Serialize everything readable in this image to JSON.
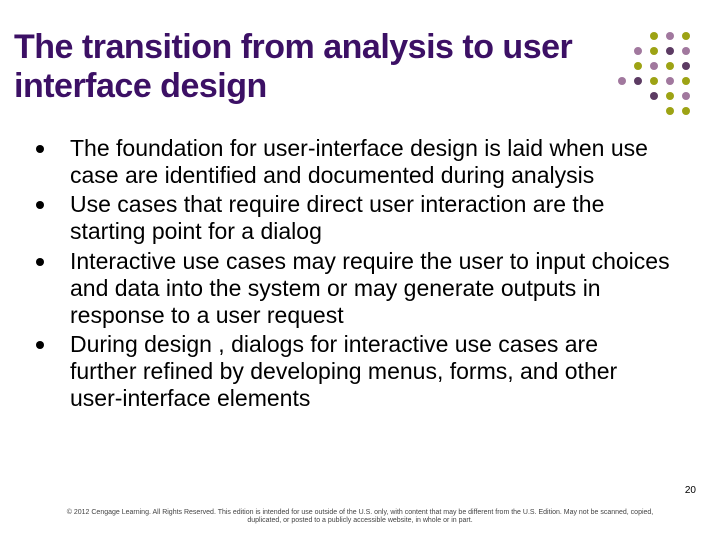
{
  "title": "The transition from analysis to user interface design",
  "bullets": [
    "The foundation for user-interface design is laid when use case are identified and documented during analysis",
    "Use cases that require direct user interaction are the starting point for a dialog",
    "Interactive use cases may require the user to input choices and data into the system or may generate outputs in response to a user request",
    "During design , dialogs for interactive use cases are further refined by developing menus, forms, and other user-interface elements"
  ],
  "page_number": "20",
  "copyright": "© 2012 Cengage Learning. All Rights Reserved. This edition is intended for use outside of the U.S. only, with content that may be different from the U.S. Edition. May not be scanned, copied, duplicated, or posted to a publicly accessible website, in whole or in part.",
  "dot_colors": {
    "olive": "#9da314",
    "plum": "#a1789e",
    "dark": "#5c3b63"
  }
}
